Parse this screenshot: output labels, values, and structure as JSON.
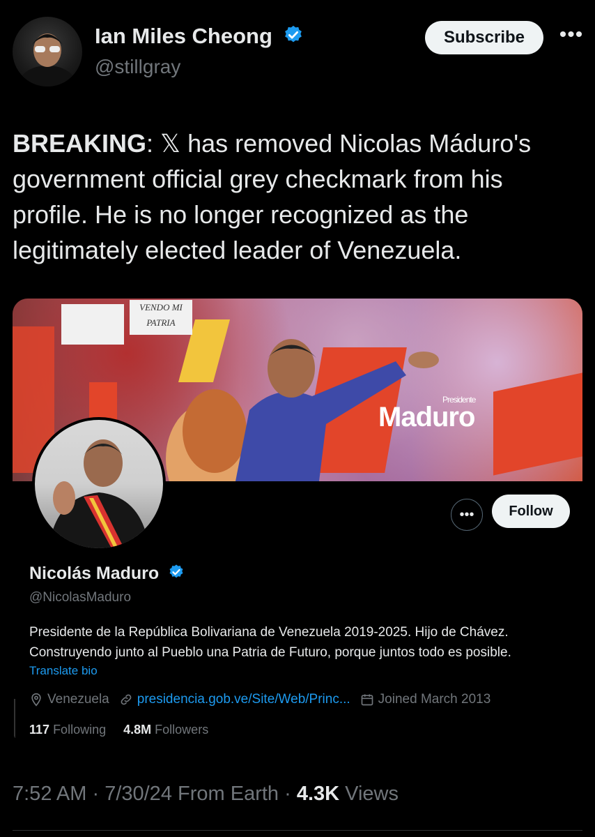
{
  "author": {
    "name": "Ian Miles Cheong",
    "handle": "@stillgray",
    "verified": true,
    "subscribe_label": "Subscribe"
  },
  "tweet": {
    "lead": "BREAKING",
    "lead_suffix": ":",
    "x_glyph": "𝕏",
    "body": " has removed Nicolas Máduro's government official grey checkmark from his profile. He is no longer recognized as the legitimately elected leader of Venezuela."
  },
  "card": {
    "banner": {
      "sign_1": "VENDO MI PATRIA",
      "logo_small": "Presidente",
      "logo_text": "Maduro"
    },
    "profile": {
      "name": "Nicolás Maduro",
      "handle": "@NicolasMaduro",
      "verified": true,
      "bio": "Presidente de la República Bolivariana de Venezuela 2019-2025. Hijo de Chávez. Construyendo junto al Pueblo una Patria de Futuro, porque juntos todo es posible.",
      "translate_label": "Translate bio",
      "location": "Venezuela",
      "link": "presidencia.gob.ve/Site/Web/Princ...",
      "joined": "Joined March 2013",
      "following_count": "117",
      "following_label": "Following",
      "followers_count": "4.8M",
      "followers_label": "Followers",
      "follow_label": "Follow"
    }
  },
  "footer": {
    "time": "7:52 AM",
    "date": "7/30/24",
    "source": "From Earth",
    "views_count": "4.3K",
    "views_label": "Views"
  },
  "colors": {
    "background": "#000000",
    "text": "#e7e9ea",
    "muted": "#71767b",
    "accent": "#1d9bf0",
    "button_bg": "#eff3f4"
  },
  "icons": [
    "verified-badge-icon",
    "more-icon",
    "location-pin-icon",
    "link-icon",
    "calendar-icon"
  ]
}
